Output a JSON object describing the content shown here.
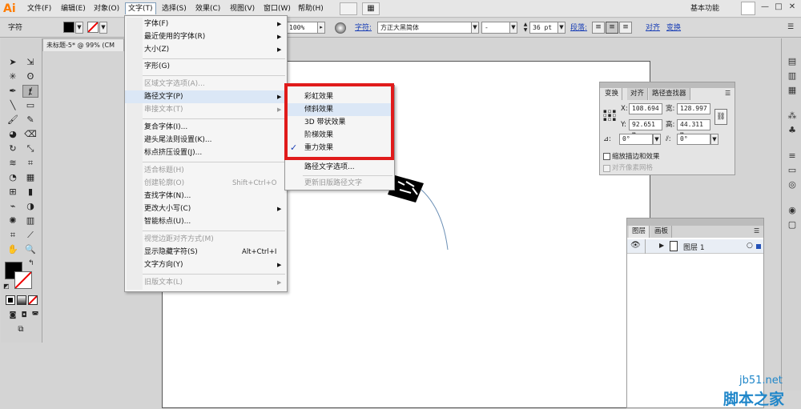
{
  "app": {
    "logo": "Ai"
  },
  "menubar": {
    "items": [
      "文件(F)",
      "编辑(E)",
      "对象(O)",
      "文字(T)",
      "选择(S)",
      "效果(C)",
      "视图(V)",
      "窗口(W)",
      "帮助(H)"
    ],
    "workspace": "基本功能",
    "window_min": "—",
    "window_max": "□",
    "window_close": "✕"
  },
  "controlbar": {
    "mode_label": "字符",
    "opacity_value": "100%",
    "char_label": "字符:",
    "font_family": "方正大黑简体",
    "font_style": "-",
    "font_size": "36 pt",
    "para_label": "段落:",
    "align_link": "对齐",
    "transform_link": "变换"
  },
  "document": {
    "tab_title": "未标题-5* @ 99% (CM"
  },
  "type_menu": {
    "items": [
      {
        "label": "字体(F)",
        "shortcut": "",
        "arrow": true,
        "disabled": false
      },
      {
        "label": "最近使用的字体(R)",
        "shortcut": "",
        "arrow": true,
        "disabled": false
      },
      {
        "label": "大小(Z)",
        "shortcut": "",
        "arrow": true,
        "disabled": false
      },
      {
        "label": "字形(G)",
        "shortcut": "",
        "arrow": false,
        "disabled": false
      },
      {
        "label": "区域文字选项(A)...",
        "shortcut": "",
        "arrow": false,
        "disabled": true
      },
      {
        "label": "路径文字(P)",
        "shortcut": "",
        "arrow": true,
        "disabled": false
      },
      {
        "label": "串接文本(T)",
        "shortcut": "",
        "arrow": true,
        "disabled": true
      },
      {
        "label": "复合字体(I)...",
        "shortcut": "",
        "arrow": false,
        "disabled": false
      },
      {
        "label": "避头尾法则设置(K)...",
        "shortcut": "",
        "arrow": false,
        "disabled": false
      },
      {
        "label": "标点挤压设置(J)...",
        "shortcut": "",
        "arrow": false,
        "disabled": false
      },
      {
        "label": "适合标题(H)",
        "shortcut": "",
        "arrow": false,
        "disabled": true
      },
      {
        "label": "创建轮廓(O)",
        "shortcut": "Shift+Ctrl+O",
        "arrow": false,
        "disabled": true
      },
      {
        "label": "查找字体(N)...",
        "shortcut": "",
        "arrow": false,
        "disabled": false
      },
      {
        "label": "更改大小写(C)",
        "shortcut": "",
        "arrow": true,
        "disabled": false
      },
      {
        "label": "智能标点(U)...",
        "shortcut": "",
        "arrow": false,
        "disabled": false
      },
      {
        "label": "视觉边距对齐方式(M)",
        "shortcut": "",
        "arrow": false,
        "disabled": true
      },
      {
        "label": "显示隐藏字符(S)",
        "shortcut": "Alt+Ctrl+I",
        "arrow": false,
        "disabled": false
      },
      {
        "label": "文字方向(Y)",
        "shortcut": "",
        "arrow": true,
        "disabled": false
      },
      {
        "label": "旧版文本(L)",
        "shortcut": "",
        "arrow": true,
        "disabled": true
      }
    ]
  },
  "path_type_submenu": {
    "items": [
      {
        "label": "彩虹效果",
        "checked": false,
        "disabled": false
      },
      {
        "label": "倾斜效果",
        "checked": false,
        "disabled": false
      },
      {
        "label": "3D 带状效果",
        "checked": false,
        "disabled": false
      },
      {
        "label": "阶梯效果",
        "checked": false,
        "disabled": false
      },
      {
        "label": "重力效果",
        "checked": true,
        "disabled": false
      },
      {
        "label": "路径文字选项...",
        "checked": false,
        "disabled": false
      },
      {
        "label": "更新旧版路径文字",
        "checked": false,
        "disabled": true
      }
    ],
    "check_mark": "✓"
  },
  "transform_panel": {
    "tabs": [
      "变换",
      "对齐",
      "路径查找器"
    ],
    "x_label": "X:",
    "x_value": "108.694",
    "w_label": "宽:",
    "w_value": "128.997",
    "y_label": "Y:",
    "y_value": "92.651 m",
    "h_label": "高:",
    "h_value": "44.311 m",
    "rotate_value": "0°",
    "shear_value": "0°",
    "scale_strokes_label": "缩放描边和效果",
    "align_pixel_label": "对齐像素网格"
  },
  "layers_panel": {
    "tabs": [
      "图层",
      "画板"
    ],
    "layer_name": "图层 1"
  },
  "watermark": {
    "site": "jb51.net",
    "name": "脚本之家"
  }
}
